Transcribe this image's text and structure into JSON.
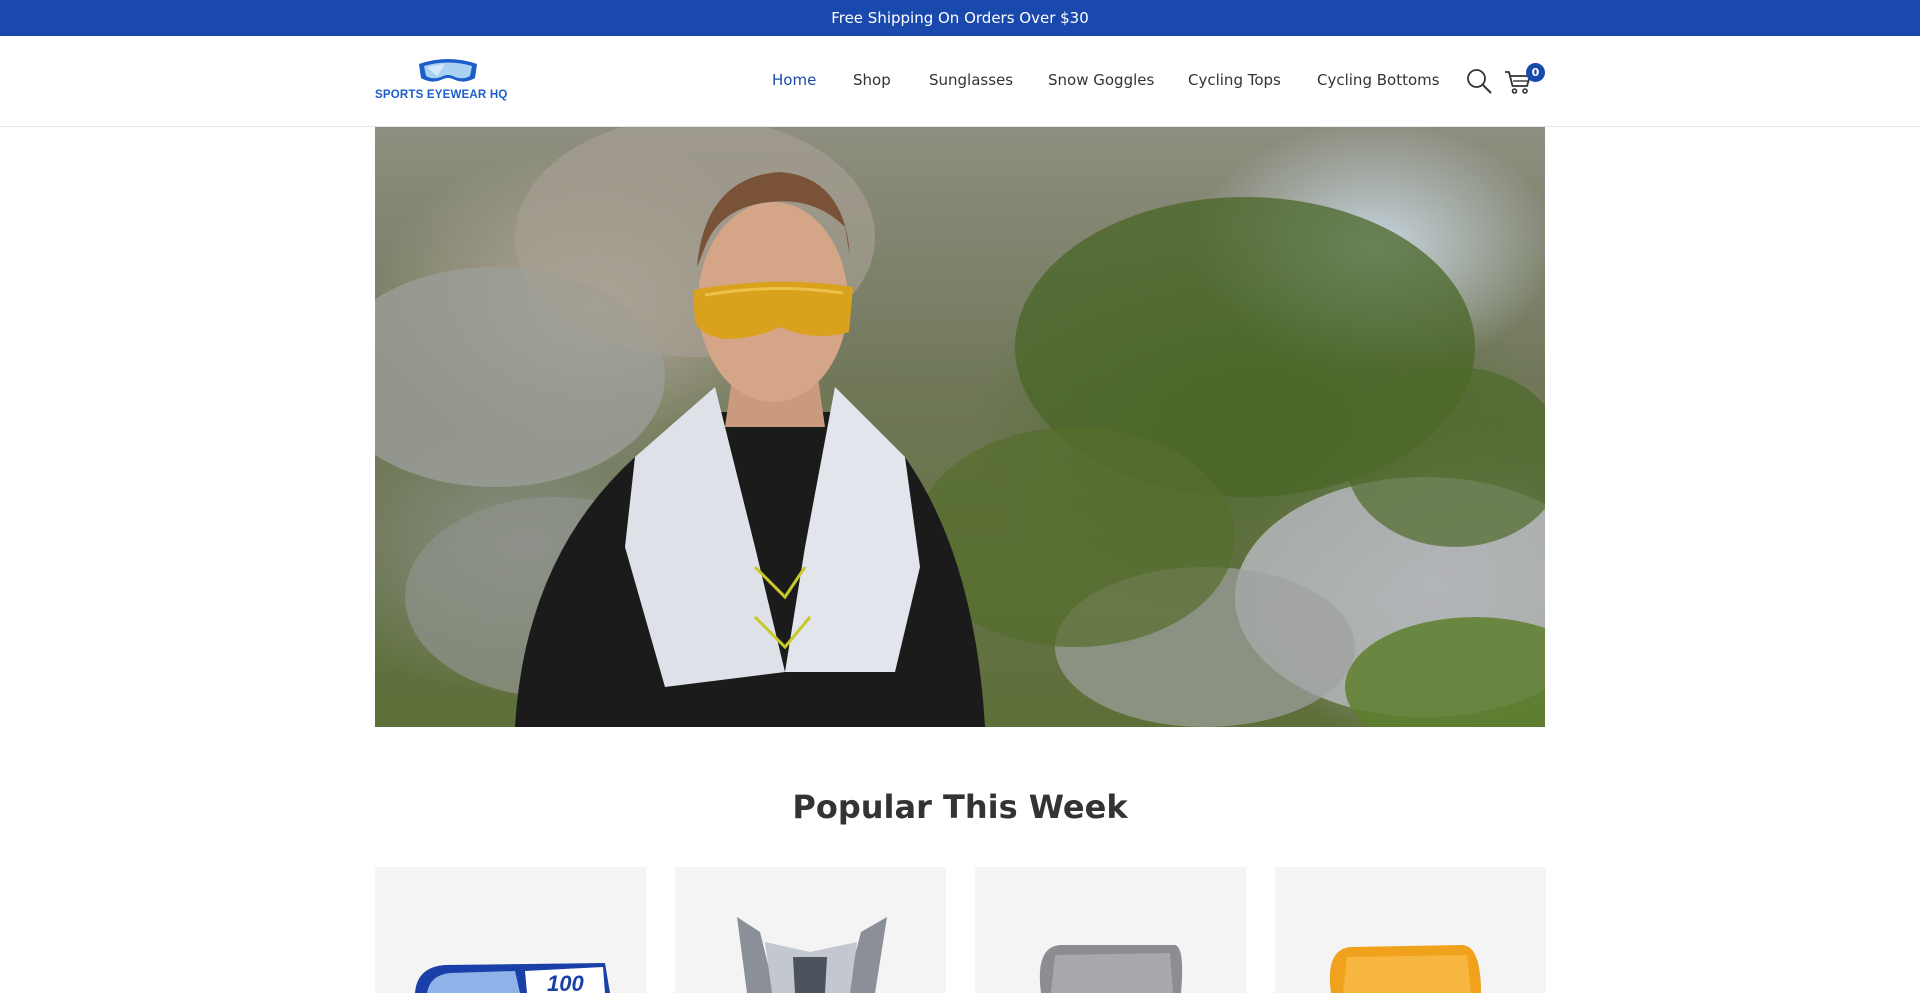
{
  "announcement": {
    "text": "Free Shipping On Orders Over $30"
  },
  "brand": {
    "name": "SPORTS EYEWEAR HQ",
    "logo_icon": "goggles-logo-icon",
    "color": "#1a49ad"
  },
  "nav": {
    "items": [
      {
        "label": "Home",
        "active": true
      },
      {
        "label": "Shop",
        "active": false
      },
      {
        "label": "Sunglasses",
        "active": false
      },
      {
        "label": "Snow Goggles",
        "active": false
      },
      {
        "label": "Cycling Tops",
        "active": false
      },
      {
        "label": "Cycling Bottoms",
        "active": false
      }
    ],
    "search_icon": "search-icon",
    "cart_icon": "cart-icon",
    "cart_count": "0"
  },
  "hero": {
    "image": "runner-with-sunglasses-photo"
  },
  "popular": {
    "title": "Popular This Week",
    "products": [
      {
        "image": "blue-motocross-goggles"
      },
      {
        "image": "grey-helmet-visor"
      },
      {
        "image": "smoke-replacement-lens"
      },
      {
        "image": "orange-replacement-lens"
      }
    ]
  }
}
